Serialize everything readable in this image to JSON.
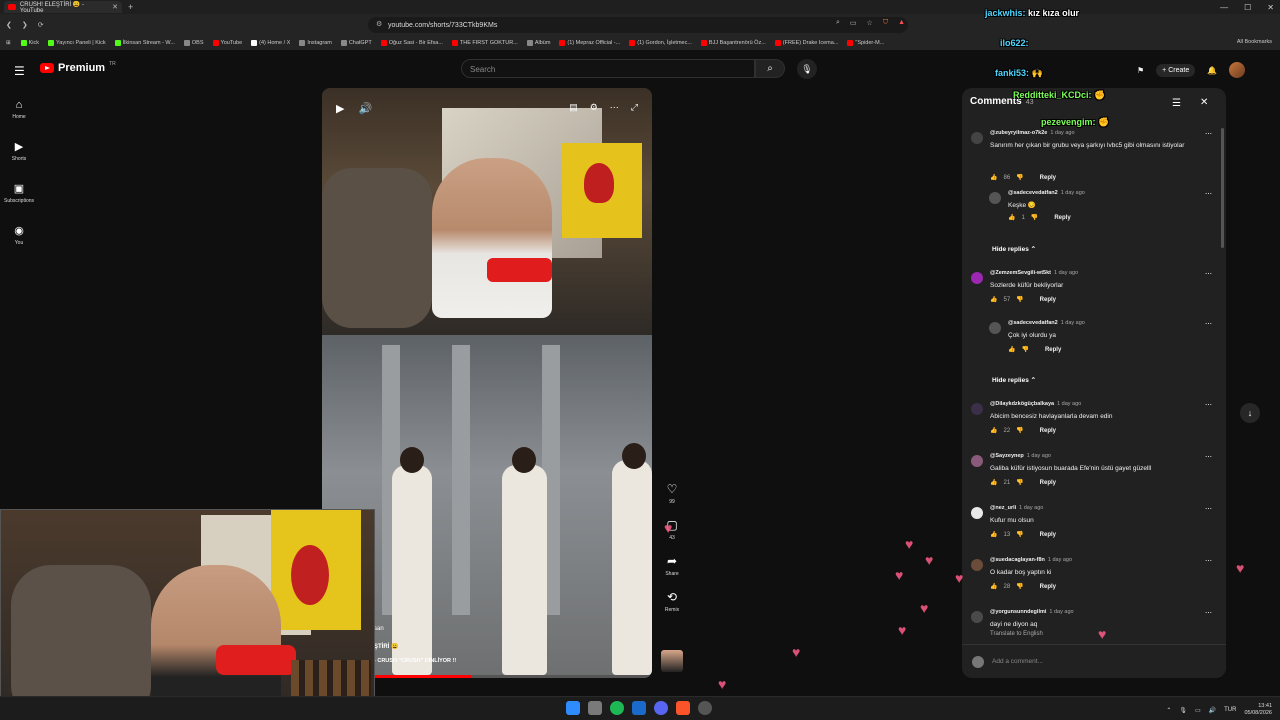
{
  "browser": {
    "tab_title": "CRUSH! ELEŞTİRİ 😩 - YouTube",
    "url": "youtube.com/shorts/733CTkb9KMs",
    "bookmarks": [
      {
        "label": "Kick",
        "kind": "kick"
      },
      {
        "label": "Yayıncı Paneli | Kick",
        "kind": "kick"
      },
      {
        "label": "İlkinsan Stream - W...",
        "kind": "kick"
      },
      {
        "label": "OBS",
        "kind": "gr"
      },
      {
        "label": "YouTube",
        "kind": "yt"
      },
      {
        "label": "(4) Home / X",
        "kind": "x"
      },
      {
        "label": "Instagram",
        "kind": "gr"
      },
      {
        "label": "ChatGPT",
        "kind": "gr"
      },
      {
        "label": "Oğuz Sasi - Bir Efsa...",
        "kind": "yt"
      },
      {
        "label": "THE FIRST GOKTUR...",
        "kind": "yt"
      },
      {
        "label": "Albüm",
        "kind": "gr"
      },
      {
        "label": "(1) Mepraz Official -...",
        "kind": "yt"
      },
      {
        "label": "(1) Gordon, İşletmec...",
        "kind": "yt"
      },
      {
        "label": "BJJ Başantrenörü Öz...",
        "kind": "yt"
      },
      {
        "label": "(FREE) Drake Icema...",
        "kind": "yt"
      },
      {
        "label": "\"Spider-M...",
        "kind": "yt"
      }
    ],
    "all_bookmarks": "All Bookmarks"
  },
  "youtube": {
    "brand": "Premium",
    "brand_region": "TR",
    "search_placeholder": "Search",
    "create_label": "Create",
    "nav": [
      {
        "label": "Home",
        "icon": "home-icon"
      },
      {
        "label": "Shorts",
        "icon": "shorts-icon"
      },
      {
        "label": "Subscriptions",
        "icon": "subscriptions-icon"
      },
      {
        "label": "You",
        "icon": "you-icon"
      }
    ]
  },
  "short": {
    "channel_suffix": "san",
    "title_line": "ŞTİRİ 😩",
    "caption": "- CRUSH \"CRUSH\" DİNLİYOR !!",
    "progress": 0.45,
    "actions": [
      {
        "name": "like",
        "icon": "heart-icon",
        "label": "99"
      },
      {
        "name": "comments",
        "icon": "comment-icon",
        "label": "43"
      },
      {
        "name": "share",
        "icon": "share-icon",
        "label": "Share"
      },
      {
        "name": "remix",
        "icon": "remix-icon",
        "label": "Remix"
      }
    ]
  },
  "comments_panel": {
    "title": "Comments",
    "count": "43",
    "add_placeholder": "Add a comment...",
    "items": [
      {
        "user": "@zubeyryilmaz-o7k2e",
        "time": "1 day ago",
        "text": "Sanırım her çıkan bir grubu veya şarkıyı lvbc5  gibi olmasını istiyolar",
        "likes": "86",
        "reply": "Reply",
        "avatar": "#444",
        "indent": false
      },
      {
        "user": "@sadecevedatfan2",
        "time": "1 day ago",
        "text": "Keşke 😔",
        "likes": "1",
        "reply": "Reply",
        "avatar": "#555",
        "indent": true
      },
      {
        "user": "@ZemzemSevgili-wt5kt",
        "time": "1 day ago",
        "text": "Sozlerde küfür bekliyorlar",
        "likes": "57",
        "reply": "Reply",
        "avatar": "#9c27b0",
        "indent": false
      },
      {
        "user": "@sadecevedatfan2",
        "time": "1 day ago",
        "text": "Çok iyi olurdu ya",
        "likes": "",
        "reply": "Reply",
        "avatar": "#555",
        "indent": true
      },
      {
        "user": "@Dilaykdzkögüçbalkaya",
        "time": "1 day ago",
        "text": "Abicim bencesiz havlayanlarla devam edin",
        "likes": "22",
        "reply": "Reply",
        "avatar": "#3c2f4a",
        "indent": false
      },
      {
        "user": "@Sayzeynep",
        "time": "1 day ago",
        "text": "Galiba küfür istiyosun buarada Efe'nin üstü gayet güzelll",
        "likes": "21",
        "reply": "Reply",
        "avatar": "#8a5a7a",
        "indent": false
      },
      {
        "user": "@nez_urli",
        "time": "1 day ago",
        "text": "Kufur mu olsun",
        "likes": "13",
        "reply": "Reply",
        "avatar": "#e8e8e8",
        "indent": false
      },
      {
        "user": "@suedacaglayan-f8n",
        "time": "1 day ago",
        "text": "O kadar boş yaptın ki",
        "likes": "28",
        "reply": "Reply",
        "avatar": "#6b4b3a",
        "indent": false
      },
      {
        "user": "@yorgunsunndegilmi",
        "time": "1 day ago",
        "text": "dayi ne diyon aq",
        "likes": "",
        "reply": "Translate to English",
        "avatar": "#4a4a4a",
        "indent": false
      }
    ],
    "hide_replies": "Hide replies"
  },
  "chat_overlay": [
    {
      "user": "jackwhis:",
      "msg": "kız kıza olur"
    },
    {
      "user": "ilo622:",
      "msg": ""
    },
    {
      "user": "fanki53:",
      "msg": "🙌"
    },
    {
      "user": "Redditteki_KCDci:",
      "msg": "✊"
    },
    {
      "user": "pezevengim:",
      "msg": "✊"
    }
  ],
  "taskbar": {
    "lang": "TUR",
    "time": "13:41",
    "date": "05/08/2026"
  }
}
